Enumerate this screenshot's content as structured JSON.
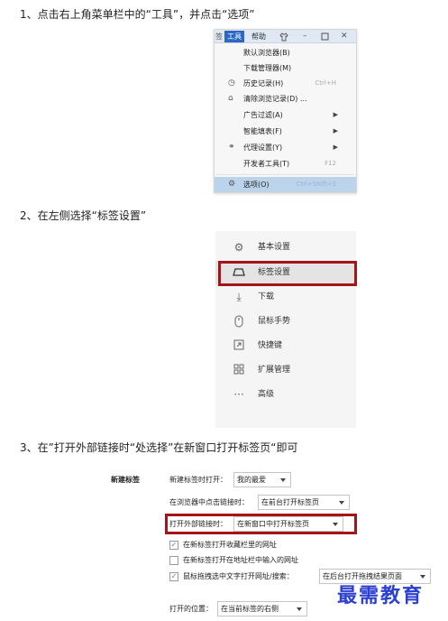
{
  "steps": {
    "step1": "1、点击右上角菜单栏中的“工具”，并点击“选项”",
    "step2": "2、在左侧选择“标签设置”",
    "step3": "3、在”打开外部链接时“处选择”在新窗口打开标签页“即可"
  },
  "menu": {
    "menubar": {
      "fragment": "签",
      "tools": "工具",
      "help": "帮助",
      "icons": [
        "shirt-icon",
        "minimize-icon",
        "restore-icon",
        "close-icon"
      ]
    },
    "items": [
      {
        "label": "默认浏览器(B)",
        "icon": "",
        "shortcut": "",
        "submenu": false
      },
      {
        "label": "下载管理器(M)",
        "icon": "",
        "shortcut": "",
        "submenu": false
      },
      {
        "label": "历史记录(H)",
        "icon": "history-icon",
        "shortcut": "Ctrl+H",
        "submenu": false
      },
      {
        "label": "清除浏览记录(D) ...",
        "icon": "broom-icon",
        "shortcut": "",
        "submenu": false
      },
      {
        "label": "广告过滤(A)",
        "icon": "",
        "shortcut": "",
        "submenu": true
      },
      {
        "label": "智能填表(F)",
        "icon": "",
        "shortcut": "",
        "submenu": true
      },
      {
        "label": "代理设置(Y)",
        "icon": "link-icon",
        "shortcut": "",
        "submenu": true
      },
      {
        "label": "开发者工具(T)",
        "icon": "",
        "shortcut": "F12",
        "submenu": false
      }
    ],
    "options": {
      "label": "选项(O)",
      "icon": "gear-icon",
      "shortcut": "Ctrl+Shift+S"
    }
  },
  "sidebar": {
    "items": [
      {
        "label": "基本设置",
        "icon": "gear-icon"
      },
      {
        "label": "标签设置",
        "icon": "tab-icon"
      },
      {
        "label": "下载",
        "icon": "download-icon"
      },
      {
        "label": "鼠标手势",
        "icon": "mouse-icon"
      },
      {
        "label": "快捷键",
        "icon": "shortcut-icon"
      },
      {
        "label": "扩展管理",
        "icon": "extensions-icon"
      },
      {
        "label": "高级",
        "icon": "more-icon"
      }
    ]
  },
  "settings": {
    "section_title": "新建标签",
    "new_tab_open_label": "新建标签时打开：",
    "new_tab_open_value": "我的最爱",
    "page_link_click_label": "在浏览器中点击链接时：",
    "page_link_click_value": "在前台打开标签页",
    "external_link_label": "打开外部链接时：",
    "external_link_value": "在新窗口中打开标签页",
    "checkboxes": [
      {
        "label": "在新标签打开收藏栏里的网址",
        "checked": true
      },
      {
        "label": "在新标签打开在地址栏中输入的网址",
        "checked": false
      },
      {
        "label": "鼠标拖拽选中文字打开网址/搜索：",
        "checked": true
      }
    ],
    "drag_select_value": "在后台打开拖拽结果页面",
    "open_position_label": "打开的位置：",
    "open_position_value": "在当前标签的右侧"
  },
  "watermark": "最需教育",
  "colors": {
    "highlight": "#a7131b",
    "menu_selected": "#bcd3ec",
    "tools_active": "#2b68c4",
    "watermark": "#2b3fd1"
  }
}
